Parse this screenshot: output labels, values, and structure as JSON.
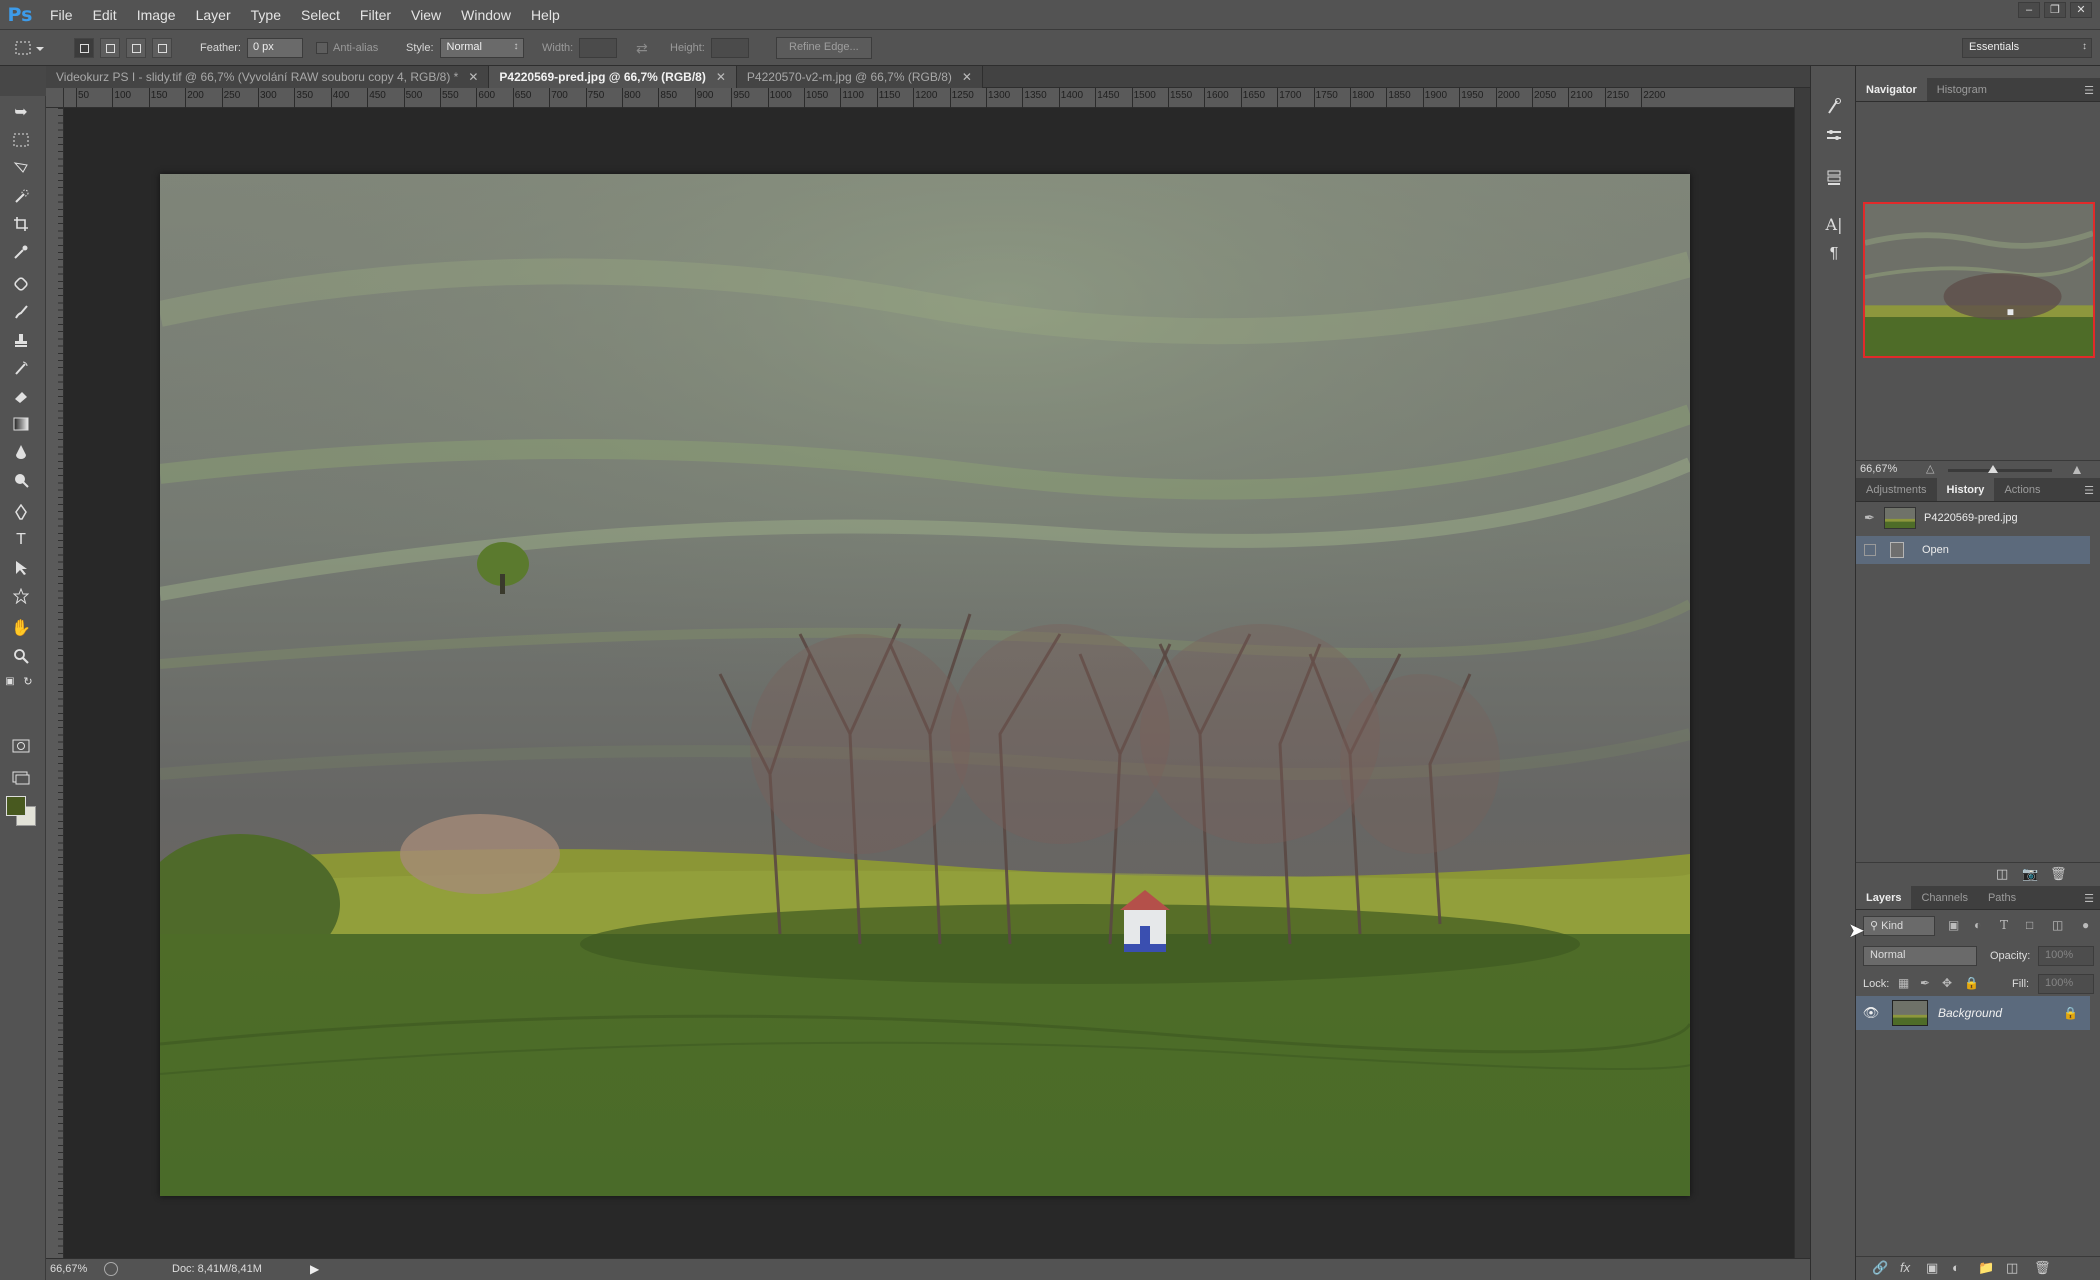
{
  "app": {
    "logo": "Ps"
  },
  "menu": [
    "File",
    "Edit",
    "Image",
    "Layer",
    "Type",
    "Select",
    "Filter",
    "View",
    "Window",
    "Help"
  ],
  "window_controls": {
    "minimize": "–",
    "restore": "❐",
    "close": "✕"
  },
  "options": {
    "feather_label": "Feather:",
    "feather_value": "0 px",
    "antialias_label": "Anti-alias",
    "style_label": "Style:",
    "style_value": "Normal",
    "width_label": "Width:",
    "height_label": "Height:",
    "refine_edge": "Refine Edge...",
    "workspace": "Essentials"
  },
  "tabs": [
    {
      "label": "Videokurz PS I - slidy.tif @ 66,7% (Vyvolání RAW souboru copy 4, RGB/8) *",
      "close": "✕"
    },
    {
      "label": "P4220569-pred.jpg @ 66,7% (RGB/8)",
      "close": "✕"
    },
    {
      "label": "P4220570-v2-m.jpg @ 66,7% (RGB/8)",
      "close": "✕"
    }
  ],
  "ruler_top": [
    "50",
    "100",
    "150",
    "200",
    "250",
    "300",
    "350",
    "400",
    "450",
    "500",
    "550",
    "600",
    "650",
    "700",
    "750",
    "800",
    "850",
    "900",
    "950",
    "1000",
    "1050",
    "1100",
    "1150",
    "1200",
    "1250",
    "1300",
    "1350",
    "1400",
    "1450",
    "1500",
    "1550",
    "1600",
    "1650",
    "1700",
    "1750",
    "1800",
    "1850",
    "1900",
    "1950",
    "2000",
    "2050",
    "2100",
    "2150",
    "2200"
  ],
  "navigator": {
    "tabs": [
      "Navigator",
      "Histogram"
    ],
    "zoom": "66,67%"
  },
  "history": {
    "tabs": [
      "Adjustments",
      "History",
      "Actions"
    ],
    "snapshot_name": "P4220569-pred.jpg",
    "steps": [
      "Open"
    ]
  },
  "layers": {
    "tabs": [
      "Layers",
      "Channels",
      "Paths"
    ],
    "filter_kind": "Kind",
    "blend_mode": "Normal",
    "opacity_label": "Opacity:",
    "opacity_value": "100%",
    "lock_label": "Lock:",
    "fill_label": "Fill:",
    "fill_value": "100%",
    "items": [
      {
        "name": "Background",
        "visible": true,
        "locked": true
      }
    ]
  },
  "status": {
    "zoom": "66,67%",
    "doc": "Doc: 8,41M/8,41M"
  },
  "colors": {
    "foreground": "#48591f",
    "background": "#e2e2d8",
    "selection_highlight": "#5c6a7c",
    "navigator_frame": "#e22a2a"
  }
}
